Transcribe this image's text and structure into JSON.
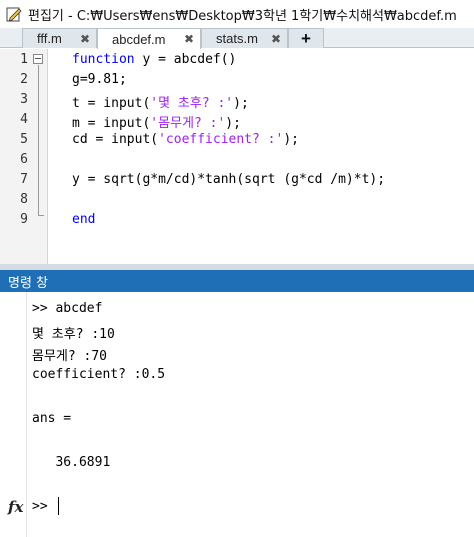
{
  "window": {
    "title": "편집기 - C:₩Users₩ens₩Desktop₩3학년 1학기₩수치해석₩abcdef.m"
  },
  "tabs": [
    {
      "label": "fff.m",
      "close": "✖"
    },
    {
      "label": "abcdef.m",
      "close": "✖"
    },
    {
      "label": "stats.m",
      "close": "✖"
    }
  ],
  "tab_add_label": "+",
  "editor": {
    "line_numbers": [
      "1",
      "2",
      "3",
      "4",
      "5",
      "6",
      "7",
      "8",
      "9"
    ],
    "lines": {
      "l1_kw": "function",
      "l1_rest": " y = abcdef()",
      "l2": "g=9.81;",
      "l3_pre": "t = input(",
      "l3_str": "'몇 초후? :'",
      "l3_post": ");",
      "l4_pre": "m = input(",
      "l4_str": "'몸무게? :'",
      "l4_post": ");",
      "l5_pre": "cd = input(",
      "l5_str": "'coefficient? :'",
      "l5_post": ");",
      "l7": "y = sqrt(g*m/cd)*tanh(sqrt (g*cd /m)*t);",
      "l9_kw": "end"
    }
  },
  "command_window": {
    "header": "명령 창",
    "lines": [
      ">> abcdef",
      "몇 초후? :10",
      "몸무게? :70",
      "coefficient? :0.5",
      "ans =",
      "   36.6891"
    ],
    "prompt": ">>",
    "fx_icon": "fx"
  }
}
